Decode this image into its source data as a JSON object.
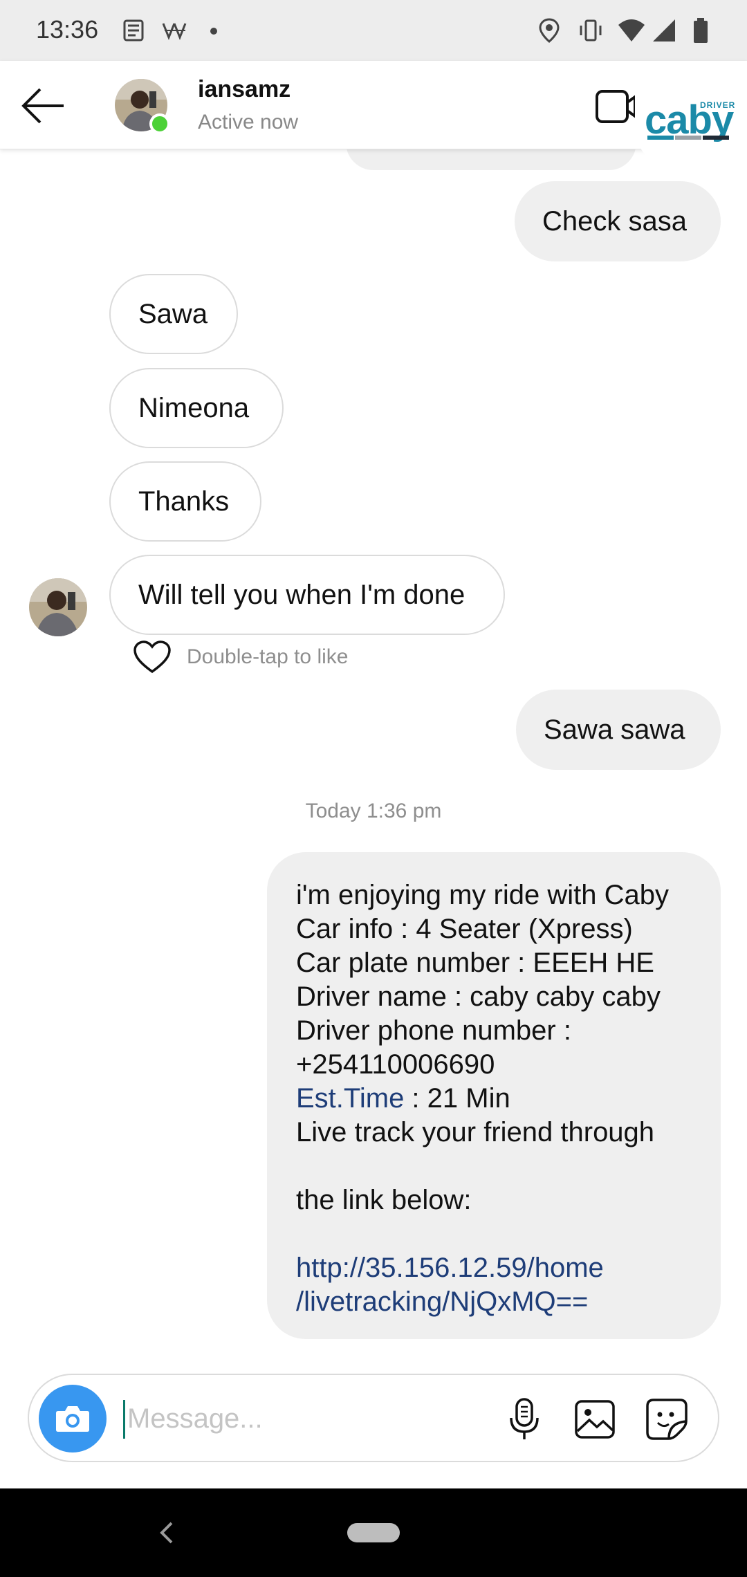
{
  "status_bar": {
    "time": "13:36",
    "left_icons": [
      "news-icon",
      "app-icon",
      "dot-icon"
    ],
    "right_icons": [
      "location-icon",
      "vibrate-icon",
      "wifi-icon",
      "signal-icon",
      "battery-icon"
    ]
  },
  "header": {
    "username": "iansamz",
    "status": "Active now",
    "brand_badge": {
      "small": "DRIVER",
      "logo": "caby"
    }
  },
  "colors": {
    "accent_blue": "#3897f0",
    "online_green": "#4cd137",
    "link_blue": "#1e3d78",
    "caby_teal": "#1b8aa8"
  },
  "messages": {
    "out_1": "Check sasa",
    "in_1": "Sawa",
    "in_2": "Nimeona",
    "in_3": "Thanks",
    "in_4": "Will tell you when I'm done",
    "like_hint": "Double-tap to like",
    "out_2": "Sawa sawa",
    "timestamp": "Today 1:36 pm",
    "share": {
      "l1": "i'm enjoying my ride with Caby",
      "l2": "Car info : 4 Seater (Xpress)",
      "l3": "Car plate number : EEEH HE",
      "l4": "Driver name : caby caby caby",
      "l5": "Driver phone number :",
      "l6": "+254110006690",
      "l7_link": "Est.Time",
      "l7_rest": " : 21 Min",
      "l8": "Live track your friend through",
      "l9": "the link below:",
      "url_1": "http://35.156.12.59/home",
      "url_2": "/livetracking/NjQxMQ=="
    }
  },
  "composer": {
    "placeholder": "Message...",
    "value": ""
  }
}
